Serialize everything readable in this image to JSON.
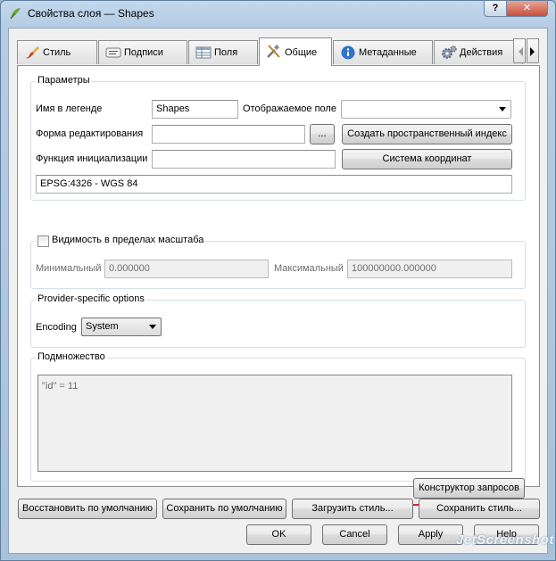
{
  "window": {
    "title": "Свойства слоя — Shapes",
    "help_label": "?",
    "close_label": "✕"
  },
  "tabs": [
    {
      "label": "Стиль",
      "icon": "paintbrush-icon"
    },
    {
      "label": "Подписи",
      "icon": "labels-icon"
    },
    {
      "label": "Поля",
      "icon": "table-icon"
    },
    {
      "label": "Общие",
      "icon": "tools-icon"
    },
    {
      "label": "Метаданные",
      "icon": "info-icon"
    },
    {
      "label": "Действия",
      "icon": "gear-icon"
    }
  ],
  "params": {
    "title": "Параметры",
    "legend_name_label": "Имя в легенде",
    "legend_name_value": "Shapes",
    "display_field_label": "Отображаемое поле",
    "display_field_value": "",
    "edit_form_label": "Форма редактирования",
    "edit_form_value": "",
    "browse_label": "...",
    "spatial_index_label": "Создать пространственный индекс",
    "init_func_label": "Функция инициализации",
    "init_func_value": "",
    "crs_button_label": "Система координат",
    "crs_value": "EPSG:4326 - WGS 84"
  },
  "scale": {
    "title": "Видимость в пределах масштаба",
    "checked": false,
    "min_label": "Минимальный",
    "min_value": "0.000000",
    "max_label": "Максимальный",
    "max_value": "100000000.000000"
  },
  "provider": {
    "title": "Provider-specific options",
    "encoding_label": "Encoding",
    "encoding_value": "System"
  },
  "subset": {
    "title": "Подмножество",
    "query": "\"id\" = 11",
    "query_builder_label": "Конструктор запросов"
  },
  "footer": {
    "restore_default": "Восстановить по умолчанию",
    "save_default": "Сохранить по умолчанию",
    "load_style": "Загрузить стиль...",
    "save_style": "Сохранить стиль...",
    "ok": "OK",
    "cancel": "Cancel",
    "apply": "Apply",
    "help": "Help"
  },
  "watermark": "JetScreenshot",
  "colors": {
    "accent_underline": "#e02020"
  }
}
